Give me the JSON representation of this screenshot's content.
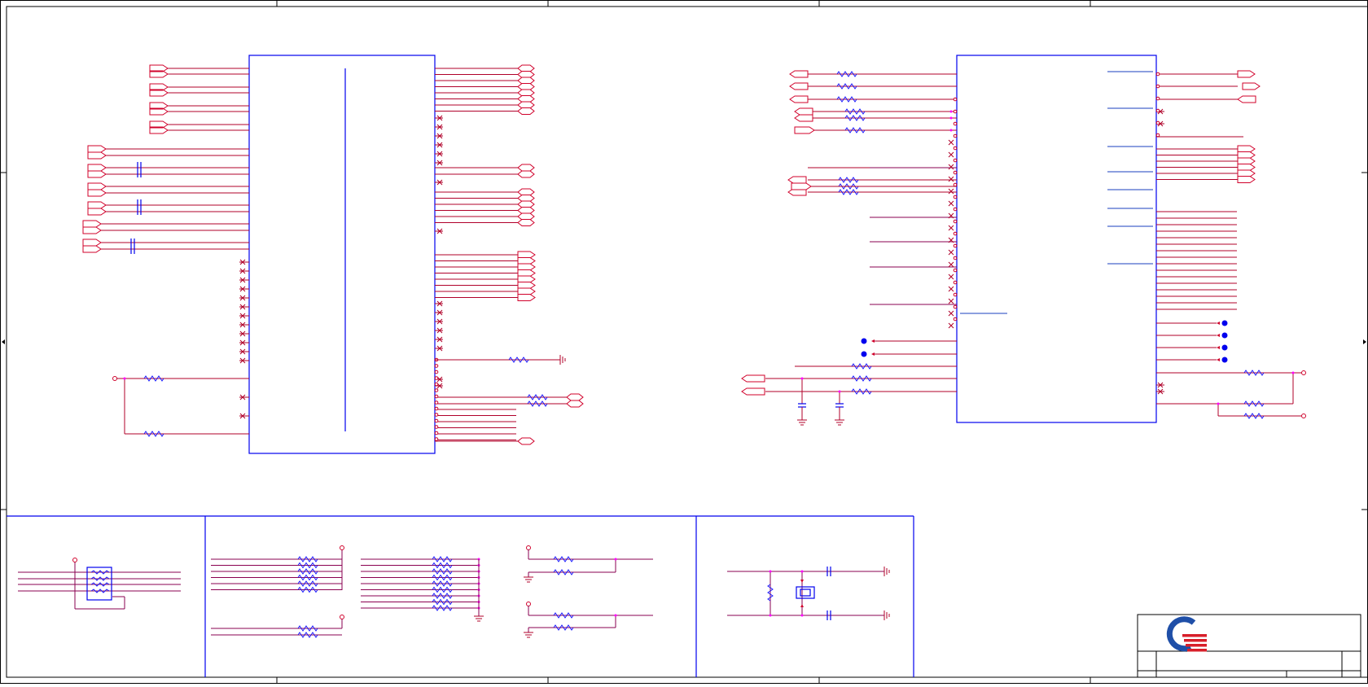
{
  "sheet": {
    "frame_color": "#000000",
    "wire_color": "#b0002a",
    "component_color": "#0000ee",
    "logo_colors": {
      "ring": "#1f4fa8",
      "stripes": "#d81f2a"
    }
  },
  "title_block": {
    "logo": "company-logo",
    "fields": []
  }
}
